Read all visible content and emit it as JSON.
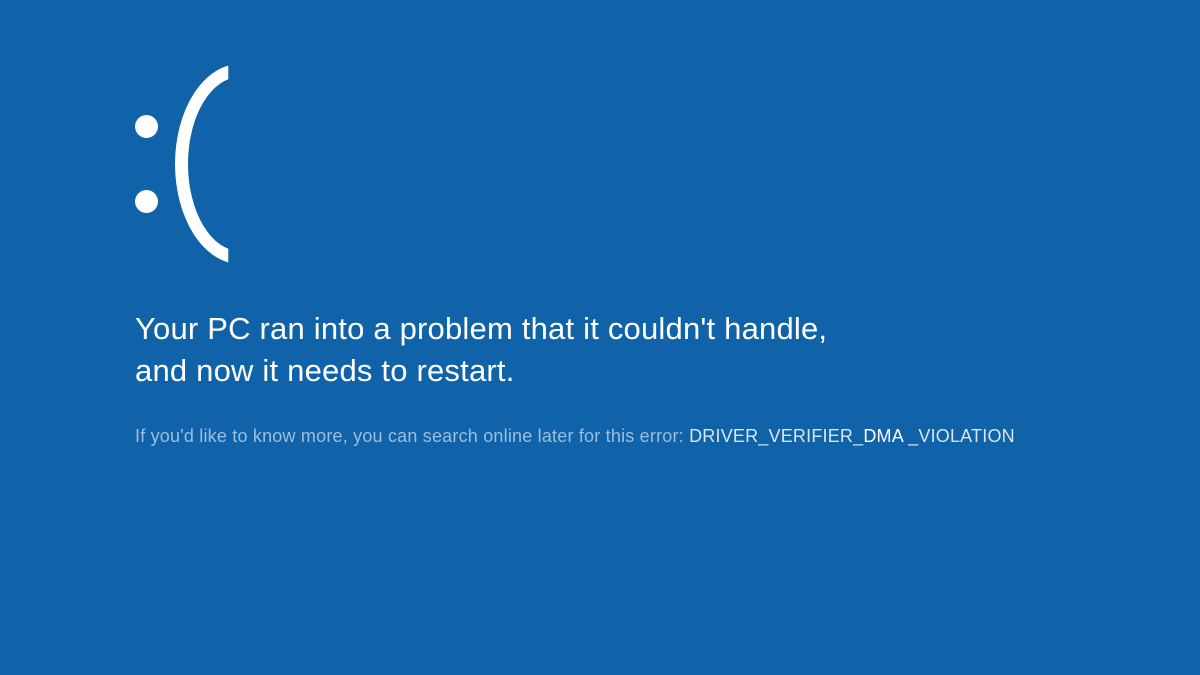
{
  "bsod": {
    "emoticon": ":(",
    "message_line1": "Your PC ran into a problem that it couldn't handle,",
    "message_line2": "and now it needs to restart.",
    "info_prefix": "If you'd like to know more, you can search online later for this error: ",
    "error_code_part1": "DRIVER_VERIFIER_",
    "error_code_dma": "DMA",
    "error_code_part3": " _VIOLATION"
  },
  "colors": {
    "background": "#1062a9",
    "text": "#ffffff",
    "info_text": "#9bbfdc"
  }
}
